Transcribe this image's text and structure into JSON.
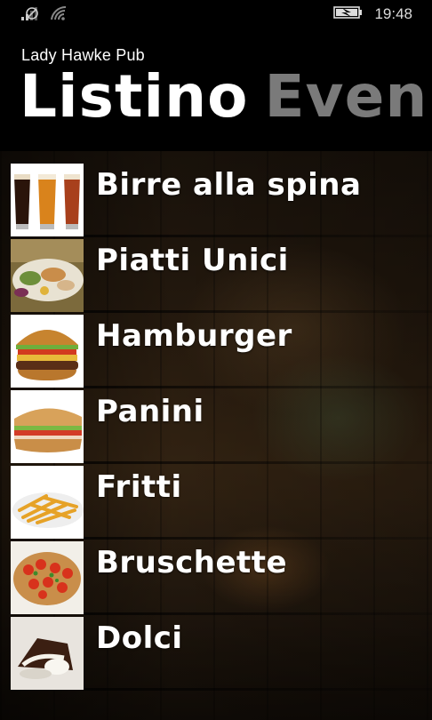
{
  "status_bar": {
    "time": "19:48",
    "icons": [
      "signal-icon",
      "no-sim-icon",
      "wifi-icon",
      "battery-charging-icon"
    ]
  },
  "header": {
    "app_name": "Lady Hawke Pub",
    "pivot_active": "Listino",
    "pivot_next": "Even"
  },
  "menu": [
    {
      "label": "Birre alla spina",
      "icon": "beer-glasses-image"
    },
    {
      "label": "Piatti Unici",
      "icon": "platter-image"
    },
    {
      "label": "Hamburger",
      "icon": "hamburger-image"
    },
    {
      "label": "Panini",
      "icon": "sandwich-image"
    },
    {
      "label": "Fritti",
      "icon": "fries-image"
    },
    {
      "label": "Bruschette",
      "icon": "bruschetta-image"
    },
    {
      "label": "Dolci",
      "icon": "dessert-image"
    }
  ],
  "colors": {
    "background": "#000000",
    "text": "#ffffff",
    "pivot_inactive": "#7a7a7a"
  }
}
